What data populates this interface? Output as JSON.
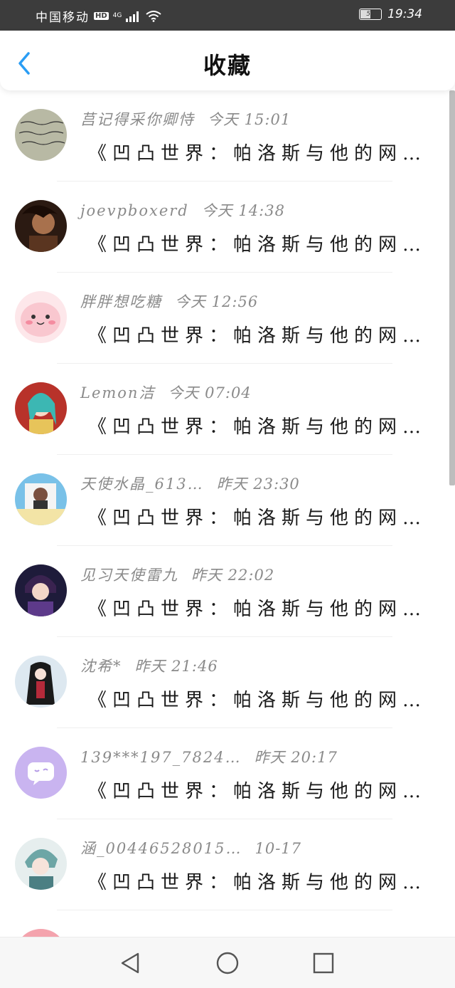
{
  "status_bar": {
    "carrier": "中国移动",
    "hd": "HD",
    "network": "4G",
    "battery": "54",
    "time": "19:34"
  },
  "header": {
    "title": "收藏",
    "back_icon": "chevron-left-icon",
    "accent_color": "#2a9df4"
  },
  "items": [
    {
      "name": "莒记得采你卿恃",
      "time": "今天 15:01",
      "content": "《凹凸世界：帕洛斯与他的网页女神》",
      "avatar": "handwriting-note-avatar"
    },
    {
      "name": "joevpboxerd",
      "time": "今天 14:38",
      "content": "《凹凸世界：帕洛斯与他的网页女神》",
      "avatar": "portrait-photo-avatar"
    },
    {
      "name": "胖胖想吃糖",
      "time": "今天 12:56",
      "content": "《凹凸世界：帕洛斯与他的网页女神》",
      "avatar": "pink-blob-avatar"
    },
    {
      "name": "Lemon洁",
      "time": "今天 07:04",
      "content": "《凹凸世界：帕洛斯与他的网页女神》",
      "avatar": "anime-girl-avatar"
    },
    {
      "name": "天使水晶_613…",
      "time": "昨天 23:30",
      "content": "《凹凸世界：帕洛斯与他的网页女神》",
      "avatar": "selfie-photo-avatar"
    },
    {
      "name": "见习天使雷九",
      "time": "昨天 22:02",
      "content": "《凹凸世界：帕洛斯与他的网页女神》",
      "avatar": "anime-boy-avatar"
    },
    {
      "name": "沈希*",
      "time": "昨天 21:46",
      "content": "《凹凸世界：帕洛斯与他的网页女神》",
      "avatar": "anime-dark-girl-avatar"
    },
    {
      "name": "139***197_7824…",
      "time": "昨天 20:17",
      "content": "《凹凸世界：帕洛斯与他的网页女神》",
      "avatar": "default-chat-avatar"
    },
    {
      "name": "涵_00446528015…",
      "time": "10-17",
      "content": "《凹凸世界：帕洛斯与他的网页女神》",
      "avatar": "anime-teal-avatar"
    },
    {
      "name": "",
      "time": "",
      "content": "",
      "avatar": "partial-avatar"
    }
  ],
  "nav": {
    "back_icon": "triangle-back-icon",
    "home_icon": "circle-home-icon",
    "recent_icon": "square-recents-icon"
  }
}
